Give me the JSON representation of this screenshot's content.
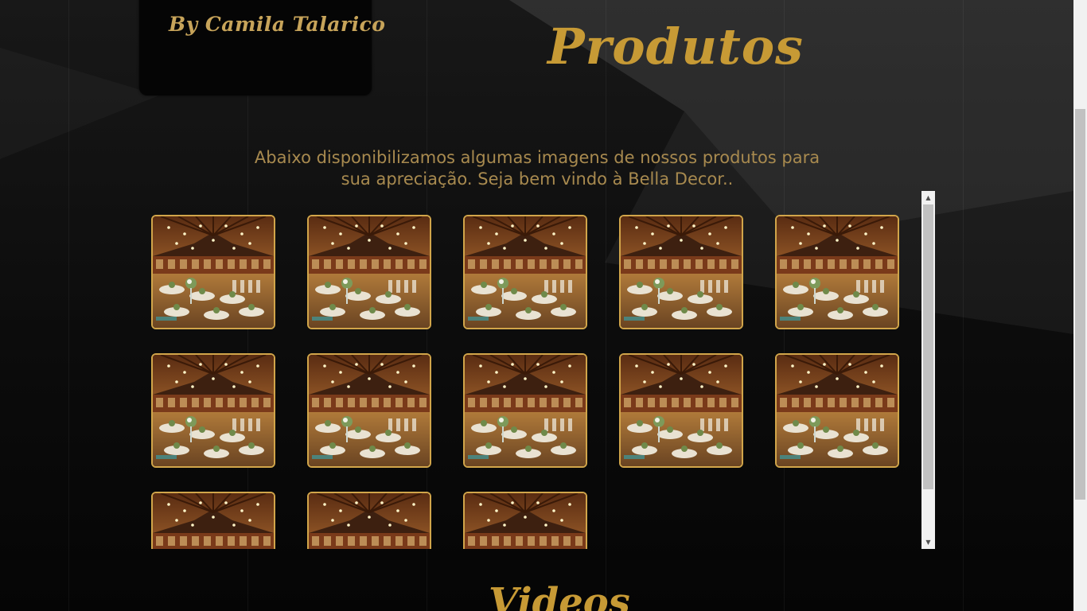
{
  "brand": {
    "logo_text": "By Camila Talarico"
  },
  "main": {
    "title": "Produtos",
    "intro": "Abaixo disponibilizamos algumas imagens de nossos produtos para sua apreciação. Seja bem vindo à Bella Decor..",
    "gallery": {
      "image_count": 13,
      "image_subject": "banquet-hall-photo",
      "border_color": "#d1a54a"
    },
    "next_section_title": "Videos"
  },
  "colors": {
    "accent_gold": "#c79a35",
    "text_gold": "#a88a4f",
    "background": "#0c0c0c"
  }
}
